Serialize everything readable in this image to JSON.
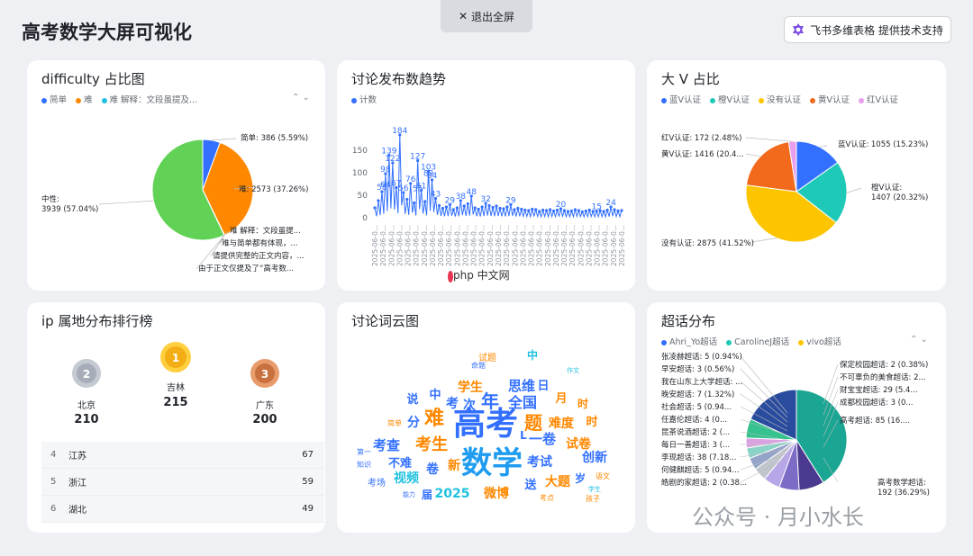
{
  "header": {
    "exit_label": "退出全屏",
    "title": "高考数学大屏可视化",
    "support_label": "飞书多维表格 提供技术支持"
  },
  "difficulty": {
    "title": "difficulty 占比图",
    "legend": [
      {
        "label": "简单",
        "color": "#3370ff"
      },
      {
        "label": "难",
        "color": "#ff8800"
      },
      {
        "label": "难  解释：文段虽提及...",
        "color": "#1fc1e0"
      }
    ],
    "chart_data": {
      "type": "pie",
      "slices": [
        {
          "label": "简单: 386 (5.59%)",
          "value": 386,
          "percent": 5.59,
          "color": "#3370ff"
        },
        {
          "label": "难: 2573 (37.26%)",
          "value": 2573,
          "percent": 37.26,
          "color": "#ff8800"
        },
        {
          "label": "难  解释：文段虽提...",
          "value": 3,
          "percent": 0.04,
          "color": "#1fc1e0"
        },
        {
          "label": "难与简单都有体现，...",
          "value": 2,
          "percent": 0.03,
          "color": "#a78bfa"
        },
        {
          "label": "请提供完整的正文内容，...",
          "value": 2,
          "percent": 0.03,
          "color": "#f5c000"
        },
        {
          "label": "由于正文仅提及了“高考数...",
          "value": 2,
          "percent": 0.03,
          "color": "#e15dc6"
        },
        {
          "label": "中性:\n3939 (57.04%)",
          "value": 3939,
          "percent": 57.04,
          "color": "#62d256"
        }
      ]
    }
  },
  "trend": {
    "title": "讨论发布数趋势",
    "legend": [
      {
        "label": "计数",
        "color": "#3370ff"
      }
    ],
    "chart_data": {
      "type": "line",
      "ylim": [
        0,
        200
      ],
      "yticks": [
        0,
        50,
        100,
        150
      ],
      "x_tick_label": "2025-06-0...",
      "x_tick_count": 31,
      "peak_labels": [
        {
          "i": 4,
          "v": 139,
          "t": "139"
        },
        {
          "i": 7,
          "v": 184,
          "t": "184"
        },
        {
          "i": 5,
          "v": 122,
          "t": "122"
        },
        {
          "i": 12,
          "v": 127,
          "t": "127"
        },
        {
          "i": 15,
          "v": 103,
          "t": "103"
        },
        {
          "i": 3,
          "v": 98,
          "t": "98"
        },
        {
          "i": 15,
          "v": 89,
          "t": "89"
        },
        {
          "i": 16,
          "v": 84,
          "t": "84"
        },
        {
          "i": 10,
          "v": 76,
          "t": "76"
        },
        {
          "i": 6,
          "v": 67,
          "t": "67"
        },
        {
          "i": 3,
          "v": 64,
          "t": "64"
        },
        {
          "i": 13,
          "v": 61,
          "t": "61"
        },
        {
          "i": 12,
          "v": 55,
          "t": "55"
        },
        {
          "i": 8,
          "v": 56,
          "t": "56"
        },
        {
          "i": 2,
          "v": 58,
          "t": "58"
        },
        {
          "i": 17,
          "v": 43,
          "t": "43"
        },
        {
          "i": 27,
          "v": 48,
          "t": "48"
        },
        {
          "i": 24,
          "v": 38,
          "t": "38"
        },
        {
          "i": 31,
          "v": 32,
          "t": "32"
        },
        {
          "i": 21,
          "v": 29,
          "t": "29"
        },
        {
          "i": 38,
          "v": 29,
          "t": "29"
        },
        {
          "i": 52,
          "v": 20,
          "t": "20"
        },
        {
          "i": 66,
          "v": 24,
          "t": "24"
        },
        {
          "i": 62,
          "v": 15,
          "t": "15"
        }
      ],
      "values": [
        22,
        38,
        58,
        98,
        139,
        122,
        67,
        184,
        56,
        41,
        76,
        33,
        127,
        61,
        36,
        103,
        84,
        43,
        27,
        21,
        24,
        29,
        18,
        22,
        38,
        26,
        31,
        48,
        22,
        19,
        24,
        32,
        27,
        23,
        26,
        21,
        20,
        24,
        29,
        18,
        21,
        19,
        17,
        16,
        19,
        18,
        14,
        17,
        16,
        18,
        15,
        17,
        20,
        16,
        14,
        15,
        18,
        16,
        13,
        15,
        17,
        14,
        15,
        16,
        14,
        17,
        24,
        18,
        15,
        16
      ]
    }
  },
  "bigv": {
    "title": "大 V 占比",
    "legend": [
      {
        "label": "蓝V认证",
        "color": "#3370ff"
      },
      {
        "label": "橙V认证",
        "color": "#1fc9b8"
      },
      {
        "label": "没有认证",
        "color": "#fdc500"
      },
      {
        "label": "黄V认证",
        "color": "#f26b1d"
      },
      {
        "label": "红V认证",
        "color": "#e89fee"
      }
    ],
    "chart_data": {
      "type": "pie",
      "slices": [
        {
          "label": "蓝V认证: 1055 (15.23%)",
          "value": 1055,
          "percent": 15.23,
          "color": "#3370ff"
        },
        {
          "label": "橙V认证:\n1407 (20.32%)",
          "value": 1407,
          "percent": 20.32,
          "color": "#1fc9b8"
        },
        {
          "label": "没有认证: 2875 (41.52%)",
          "value": 2875,
          "percent": 41.52,
          "color": "#fdc500"
        },
        {
          "label": "黄V认证: 1416 (20.4...",
          "value": 1416,
          "percent": 20.45,
          "color": "#f26b1d"
        },
        {
          "label": "红V认证: 172 (2.48%)",
          "value": 172,
          "percent": 2.48,
          "color": "#e89fee"
        }
      ]
    }
  },
  "ip": {
    "title": "ip 属地分布排行榜",
    "podium": [
      {
        "rank": "2",
        "city": "北京",
        "value": "210"
      },
      {
        "rank": "1",
        "city": "吉林",
        "value": "215"
      },
      {
        "rank": "3",
        "city": "广东",
        "value": "200"
      }
    ],
    "rows": [
      {
        "rank": "4",
        "city": "江苏",
        "value": "67"
      },
      {
        "rank": "5",
        "city": "浙江",
        "value": "59"
      },
      {
        "rank": "6",
        "city": "湖北",
        "value": "49"
      }
    ]
  },
  "wordcloud": {
    "title": "讨论词云图",
    "words": [
      {
        "t": "高考",
        "s": 36,
        "c": "#3370ff"
      },
      {
        "t": "数学",
        "s": 34,
        "c": "#1f9cf0"
      },
      {
        "t": "难",
        "s": 22,
        "c": "#ff8800"
      },
      {
        "t": "年",
        "s": 20,
        "c": "#3370ff"
      },
      {
        "t": "考生",
        "s": 18,
        "c": "#ff8800"
      },
      {
        "t": "全国",
        "s": 16,
        "c": "#3370ff"
      },
      {
        "t": "题",
        "s": 20,
        "c": "#ff8800"
      },
      {
        "t": "学生",
        "s": 14,
        "c": "#ff8800"
      },
      {
        "t": "思维",
        "s": 15,
        "c": "#3370ff"
      },
      {
        "t": "一卷",
        "s": 15,
        "c": "#3370ff"
      },
      {
        "t": "考查",
        "s": 15,
        "c": "#3370ff"
      },
      {
        "t": "难度",
        "s": 14,
        "c": "#ff8800"
      },
      {
        "t": "试卷",
        "s": 14,
        "c": "#ff8800"
      },
      {
        "t": "创新",
        "s": 14,
        "c": "#3370ff"
      },
      {
        "t": "考试",
        "s": 14,
        "c": "#3370ff"
      },
      {
        "t": "大题",
        "s": 14,
        "c": "#ff8800"
      },
      {
        "t": "2025",
        "s": 14,
        "c": "#1fc1e0"
      },
      {
        "t": "微博",
        "s": 14,
        "c": "#ff8800"
      },
      {
        "t": "视频",
        "s": 14,
        "c": "#1fc1e0"
      },
      {
        "t": "不难",
        "s": 13,
        "c": "#3370ff"
      },
      {
        "t": "卷",
        "s": 14,
        "c": "#3370ff"
      },
      {
        "t": "新",
        "s": 14,
        "c": "#ff8800"
      },
      {
        "t": "送",
        "s": 13,
        "c": "#3370ff"
      },
      {
        "t": "时",
        "s": 13,
        "c": "#ff8800"
      },
      {
        "t": "月",
        "s": 13,
        "c": "#ff8800"
      },
      {
        "t": "日",
        "s": 13,
        "c": "#3370ff"
      },
      {
        "t": "时",
        "s": 12,
        "c": "#ff8800"
      },
      {
        "t": "分",
        "s": 14,
        "c": "#3370ff"
      },
      {
        "t": "说",
        "s": 13,
        "c": "#3370ff"
      },
      {
        "t": "中",
        "s": 13,
        "c": "#3370ff"
      },
      {
        "t": "考",
        "s": 14,
        "c": "#3370ff"
      },
      {
        "t": "次",
        "s": 14,
        "c": "#3370ff"
      },
      {
        "t": "届",
        "s": 12,
        "c": "#3370ff"
      },
      {
        "t": "考场",
        "s": 10,
        "c": "#3370ff"
      },
      {
        "t": "试题",
        "s": 10,
        "c": "#ff8800"
      },
      {
        "t": "岁",
        "s": 12,
        "c": "#3370ff"
      },
      {
        "t": "语文",
        "s": 8,
        "c": "#ff8800"
      },
      {
        "t": "知识",
        "s": 8,
        "c": "#3370ff"
      },
      {
        "t": "第一",
        "s": 8,
        "c": "#3370ff"
      },
      {
        "t": "考点",
        "s": 8,
        "c": "#ff8800"
      },
      {
        "t": "孩子",
        "s": 8,
        "c": "#ff8800"
      },
      {
        "t": "命题",
        "s": 8,
        "c": "#3370ff"
      },
      {
        "t": "简单",
        "s": 8,
        "c": "#ff8800"
      },
      {
        "t": "能力",
        "s": 7,
        "c": "#3370ff"
      },
      {
        "t": "学生",
        "s": 7,
        "c": "#1fc1e0"
      },
      {
        "t": "作文",
        "s": 7,
        "c": "#1fc1e0"
      },
      {
        "t": "L",
        "s": 12,
        "c": "#3370ff"
      },
      {
        "t": "中",
        "s": 12,
        "c": "#1fc1e0"
      }
    ]
  },
  "supertopic": {
    "title": "超话分布",
    "legend": [
      {
        "label": "Ahri_Yo超话",
        "color": "#3370ff"
      },
      {
        "label": "CarolineJ超话",
        "color": "#1fc9b8"
      },
      {
        "label": "vivo超话",
        "color": "#fdc500"
      }
    ],
    "chart_data": {
      "type": "pie",
      "left_labels": [
        "张凌赫超话: 5 (0.94%)",
        "早安超话: 3 (0.56%)",
        "我在山东上大学超话: ...",
        "晚安超话: 7 (1.32%)",
        "社会超话: 5 (0.94...",
        "任嘉伦超话: 4 (0...",
        "昆茶说酒超话: 2 (...",
        "每日一善超话: 3 (...",
        "李现超话: 38 (7.18...",
        "何健麒超话: 5 (0.94...",
        "皓剧的家超话: 2 (0.38..."
      ],
      "right_labels": [
        "保定校园超话: 2 (0.38%)",
        "不可辜负的美食超话: 2...",
        "财宝宝超话: 29 (5.4...",
        "成都校园超话: 3 (0...",
        "高考超话: 85 (16....",
        "高考数学超话:\n192 (36.29%)"
      ],
      "slices": [
        {
          "name": "高考数学超话",
          "value": 192,
          "color": "#1aa693"
        },
        {
          "name": "李现超话",
          "value": 38,
          "color": "#4b3a8f"
        },
        {
          "name": "other-a",
          "value": 30,
          "color": "#7d6bc6"
        },
        {
          "name": "other-b",
          "value": 25,
          "color": "#b7a6e8"
        },
        {
          "name": "other-c",
          "value": 20,
          "color": "#c0c4cc"
        },
        {
          "name": "other-d",
          "value": 18,
          "color": "#94a3c8"
        },
        {
          "name": "other-e",
          "value": 16,
          "color": "#8cd3c7"
        },
        {
          "name": "other-f",
          "value": 15,
          "color": "#d9a3e0"
        },
        {
          "name": "财宝宝超话",
          "value": 29,
          "color": "#34c38f"
        },
        {
          "name": "高考超话",
          "value": 85,
          "color": "#2a4c9f"
        }
      ]
    }
  },
  "watermark": "公众号 · 月小水长",
  "php_logo": "php 中文网"
}
